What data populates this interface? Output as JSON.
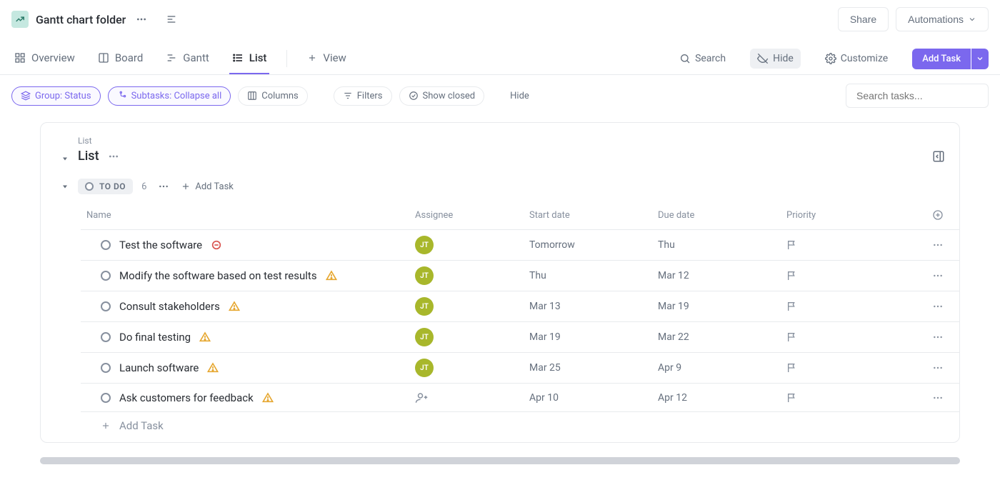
{
  "header": {
    "folder_title": "Gantt chart folder",
    "share": "Share",
    "automations": "Automations"
  },
  "views": {
    "overview": "Overview",
    "board": "Board",
    "gantt": "Gantt",
    "list": "List",
    "add_view": "View"
  },
  "toolbar": {
    "search": "Search",
    "hide": "Hide",
    "customize": "Customize",
    "add_task": "Add Task"
  },
  "filters": {
    "group": "Group: Status",
    "subtasks": "Subtasks: Collapse all",
    "columns": "Columns",
    "filters": "Filters",
    "show_closed": "Show closed",
    "hide": "Hide",
    "search_placeholder": "Search tasks..."
  },
  "panel": {
    "breadcrumb": "List",
    "title": "List"
  },
  "status": {
    "name": "TO DO",
    "count": "6",
    "add_task": "Add Task"
  },
  "columns": {
    "name": "Name",
    "assignee": "Assignee",
    "start": "Start date",
    "due": "Due date",
    "priority": "Priority"
  },
  "assignee_initials": "JT",
  "tasks": [
    {
      "name": "Test the software",
      "warn": "red-circle",
      "assignee": "JT",
      "start": "Tomorrow",
      "due": "Thu"
    },
    {
      "name": "Modify the software based on test results",
      "warn": "tri",
      "assignee": "JT",
      "start": "Thu",
      "due": "Mar 12"
    },
    {
      "name": "Consult stakeholders",
      "warn": "tri",
      "assignee": "JT",
      "start": "Mar 13",
      "due": "Mar 19"
    },
    {
      "name": "Do final testing",
      "warn": "tri",
      "assignee": "JT",
      "start": "Mar 19",
      "due": "Mar 22"
    },
    {
      "name": "Launch software",
      "warn": "tri",
      "assignee": "JT",
      "start": "Mar 25",
      "due": "Apr 9"
    },
    {
      "name": "Ask customers for feedback",
      "warn": "tri",
      "assignee": "none",
      "start": "Apr 10",
      "due": "Apr 12"
    }
  ],
  "add_task_row": "Add Task"
}
